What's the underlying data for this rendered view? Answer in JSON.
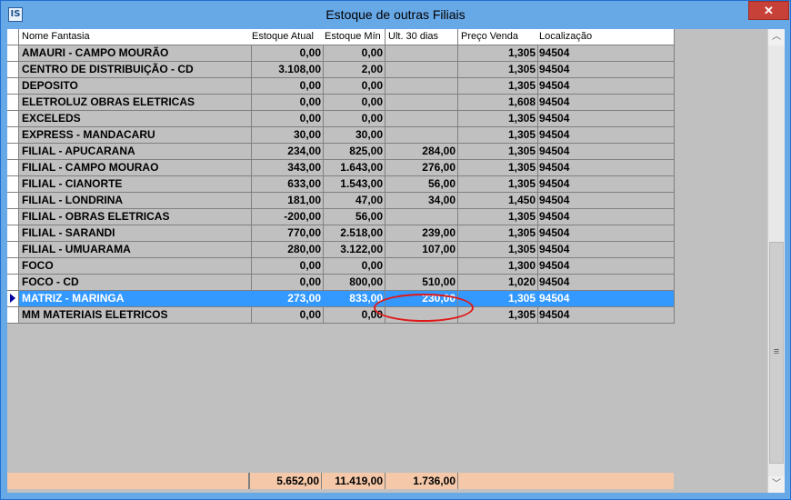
{
  "window": {
    "title": "Estoque de outras Filiais",
    "icon_text": "IS",
    "close_label": "✕"
  },
  "columns": [
    "Nome Fantasia",
    "Estoque Atual",
    "Estoque Mín",
    "Ult. 30 dias",
    "Preço Venda",
    "Localização"
  ],
  "rows": [
    [
      "AMAURI - CAMPO MOURÃO",
      "0,00",
      "0,00",
      "",
      "1,305",
      "94504"
    ],
    [
      "CENTRO DE DISTRIBUIÇÃO - CD",
      "3.108,00",
      "2,00",
      "",
      "1,305",
      "94504"
    ],
    [
      "DEPOSITO",
      "0,00",
      "0,00",
      "",
      "1,305",
      "94504"
    ],
    [
      "ELETROLUZ OBRAS ELETRICAS",
      "0,00",
      "0,00",
      "",
      "1,608",
      "94504"
    ],
    [
      "EXCELEDS",
      "0,00",
      "0,00",
      "",
      "1,305",
      "94504"
    ],
    [
      "EXPRESS - MANDACARU",
      "30,00",
      "30,00",
      "",
      "1,305",
      "94504"
    ],
    [
      "FILIAL - APUCARANA",
      "234,00",
      "825,00",
      "284,00",
      "1,305",
      "94504"
    ],
    [
      "FILIAL - CAMPO MOURAO",
      "343,00",
      "1.643,00",
      "276,00",
      "1,305",
      "94504"
    ],
    [
      "FILIAL - CIANORTE",
      "633,00",
      "1.543,00",
      "56,00",
      "1,305",
      "94504"
    ],
    [
      "FILIAL - LONDRINA",
      "181,00",
      "47,00",
      "34,00",
      "1,450",
      "94504"
    ],
    [
      "FILIAL - OBRAS ELETRICAS",
      "-200,00",
      "56,00",
      "",
      "1,305",
      "94504"
    ],
    [
      "FILIAL - SARANDI",
      "770,00",
      "2.518,00",
      "239,00",
      "1,305",
      "94504"
    ],
    [
      "FILIAL - UMUARAMA",
      "280,00",
      "3.122,00",
      "107,00",
      "1,305",
      "94504"
    ],
    [
      "FOCO",
      "0,00",
      "0,00",
      "",
      "1,300",
      "94504"
    ],
    [
      "FOCO - CD",
      "0,00",
      "800,00",
      "510,00",
      "1,020",
      "94504"
    ],
    [
      "MATRIZ - MARINGA",
      "273,00",
      "833,00",
      "230,00",
      "1,305",
      "94504"
    ],
    [
      "MM MATERIAIS ELETRICOS",
      "0,00",
      "0,00",
      "",
      "1,305",
      "94504"
    ]
  ],
  "selected_row": 15,
  "totals": {
    "estoque_atual": "5.652,00",
    "estoque_min": "11.419,00",
    "ult_30_dias": "1.736,00"
  },
  "scrollbar": {
    "up": "︿",
    "down": "﹀",
    "grip": "≡"
  },
  "colors": {
    "selection": "#3399ff",
    "totals_bg": "#f4c8a8",
    "annotation": "#e01818",
    "titlebar": "#67a8e7"
  }
}
